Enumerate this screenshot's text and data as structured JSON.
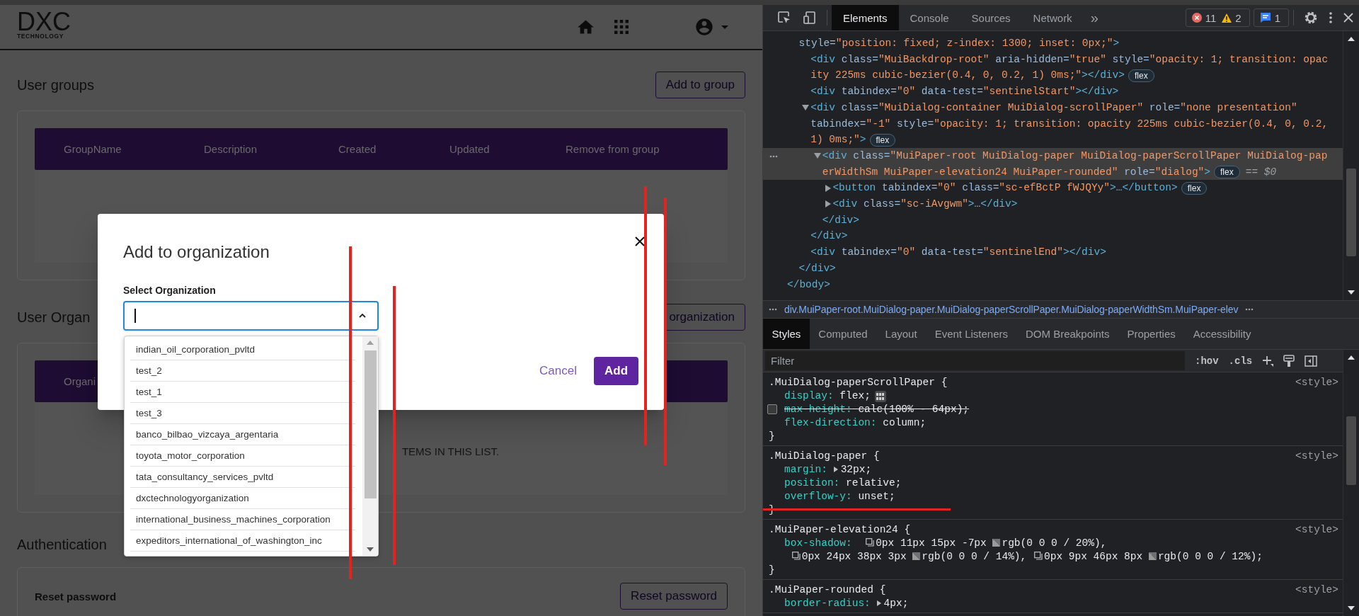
{
  "page": {
    "logo": {
      "mark": "DXC",
      "tagline": "TECHNOLOGY"
    },
    "sections": [
      {
        "kind": "table",
        "title": "User groups",
        "button": "Add to group",
        "columns": [
          "GroupName",
          "Description",
          "Created",
          "Updated",
          "Remove from group"
        ]
      },
      {
        "kind": "table",
        "title": "User Organ",
        "button": "organization",
        "columns": [
          "Organi"
        ],
        "empty_text": "TEMS IN THIS LIST."
      },
      {
        "kind": "actions",
        "title": "Authentication",
        "rows": [
          {
            "label": "Reset password",
            "button": "Reset password"
          }
        ]
      }
    ]
  },
  "dialog": {
    "title": "Add to organization",
    "field": {
      "label": "Select Organization",
      "expanded": true
    },
    "options": [
      "indian_oil_corporation_pvltd",
      "test_2",
      "test_1",
      "test_3",
      "banco_bilbao_vizcaya_argentaria",
      "toyota_motor_corporation",
      "tata_consultancy_services_pvltd",
      "dxctechnologyorganization",
      "international_business_machines_corporation",
      "expeditors_international_of_washington_inc"
    ],
    "buttons": [
      {
        "label": "Cancel",
        "kind": "text"
      },
      {
        "label": "Add",
        "kind": "primary"
      }
    ]
  },
  "devtools": {
    "tabs": [
      {
        "label": "Elements",
        "selected": true
      },
      {
        "label": "Console",
        "selected": false
      },
      {
        "label": "Sources",
        "selected": false
      },
      {
        "label": "Network",
        "selected": false
      }
    ],
    "more": "»",
    "issues": {
      "errors": "11",
      "warnings": "2",
      "messages": "1"
    },
    "dom": {
      "close": "</body>",
      "children": [
        {
          "lines": [
            "style=\"position: fixed; z-index: 1300; inset: 0px;\">"
          ],
          "selected": false,
          "close": "</div>",
          "children": [
            {
              "lines": [
                "<div class=\"MuiBackdrop-root\" aria-hidden=\"true\" style=\"opacity: 1; transition: opac",
                "ity 225ms cubic-bezier(0.4, 0, 0.2, 1) 0ms;\"></div>"
              ],
              "badge": "flex",
              "selected": false
            },
            {
              "lines": [
                "<div tabindex=\"0\" data-test=\"sentinelStart\"></div>"
              ],
              "selected": false
            },
            {
              "lines": [
                "<div class=\"MuiDialog-container MuiDialog-scrollPaper\" role=\"none presentation\"",
                "tabindex=\"-1\" style=\"opacity: 1; transition: opacity 225ms cubic-bezier(0.4, 0, 0.2,",
                "1) 0ms;\">"
              ],
              "badge": "flex",
              "expanded": true,
              "selected": false,
              "close": "</div>",
              "children": [
                {
                  "lines": [
                    "<div class=\"MuiPaper-root MuiDialog-paper MuiDialog-paperScrollPaper MuiDialog-pap",
                    "erWidthSm MuiPaper-elevation24 MuiPaper-rounded\" role=\"dialog\">"
                  ],
                  "badge": "flex",
                  "ref": "== $0",
                  "expanded": true,
                  "selected": true,
                  "close": "</div>",
                  "children": [
                    {
                      "lines": [
                        "<button tabindex=\"0\" class=\"sc-efBctP fWJQYy\">…</button>"
                      ],
                      "badge": "flex",
                      "expanded": false,
                      "selected": false
                    },
                    {
                      "lines": [
                        "<div class=\"sc-iAvgwm\">…</div>"
                      ],
                      "expanded": false,
                      "selected": false
                    }
                  ]
                }
              ]
            },
            {
              "lines": [
                "<div tabindex=\"0\" data-test=\"sentinelEnd\"></div>"
              ],
              "selected": false
            }
          ]
        }
      ]
    },
    "breadcrumb": "div.MuiPaper-root.MuiDialog-paper.MuiDialog-paperScrollPaper.MuiDialog-paperWidthSm.MuiPaper-elev",
    "pane_tabs": [
      {
        "label": "Styles",
        "selected": true
      },
      {
        "label": "Computed",
        "selected": false
      },
      {
        "label": "Layout",
        "selected": false
      },
      {
        "label": "Event Listeners",
        "selected": false
      },
      {
        "label": "DOM Breakpoints",
        "selected": false
      },
      {
        "label": "Properties",
        "selected": false
      },
      {
        "label": "Accessibility",
        "selected": false
      }
    ],
    "filter": {
      "placeholder": "Filter"
    },
    "filter_buttons": [
      ":hov",
      ".cls"
    ],
    "rules": [
      {
        "selector": ".MuiDialog-paperScrollPaper {",
        "source": "<style>",
        "close": "}",
        "declarations": [
          {
            "name": "display:",
            "value": "flex;",
            "enabled": true,
            "editor": true
          },
          {
            "name": "max-height:",
            "value": "calc(100% - 64px);",
            "enabled": false
          },
          {
            "name": "flex-direction:",
            "value": "column;",
            "enabled": true
          }
        ]
      },
      {
        "selector": ".MuiDialog-paper {",
        "source": "<style>",
        "close": "}",
        "declarations": [
          {
            "name": "margin:",
            "value": "32px;",
            "enabled": true,
            "expandable": true
          },
          {
            "name": "position:",
            "value": "relative;",
            "enabled": true
          },
          {
            "name": "overflow-y:",
            "value": "unset;",
            "enabled": true
          }
        ]
      },
      {
        "selector": ".MuiPaper-elevation24 {",
        "source": "<style>",
        "close": "}",
        "declarations": [
          {
            "name": "box-shadow:",
            "enabled": true,
            "shadows": [
              {
                "offsets": "0px 11px 15px -7px",
                "rgb": "rgb(0 0 0 / 20%),"
              },
              {
                "offsets": "0px 24px 38px 3px",
                "rgb": "rgb(0 0 0 / 14%),"
              },
              {
                "offsets": "0px 9px 46px 8px",
                "rgb": "rgb(0 0 0 / 12%);"
              }
            ]
          }
        ]
      },
      {
        "selector": ".MuiPaper-rounded {",
        "source": "<style>",
        "declarations": [
          {
            "name": "border-radius:",
            "value": "4px;",
            "enabled": true,
            "expandable": true
          }
        ]
      }
    ]
  }
}
